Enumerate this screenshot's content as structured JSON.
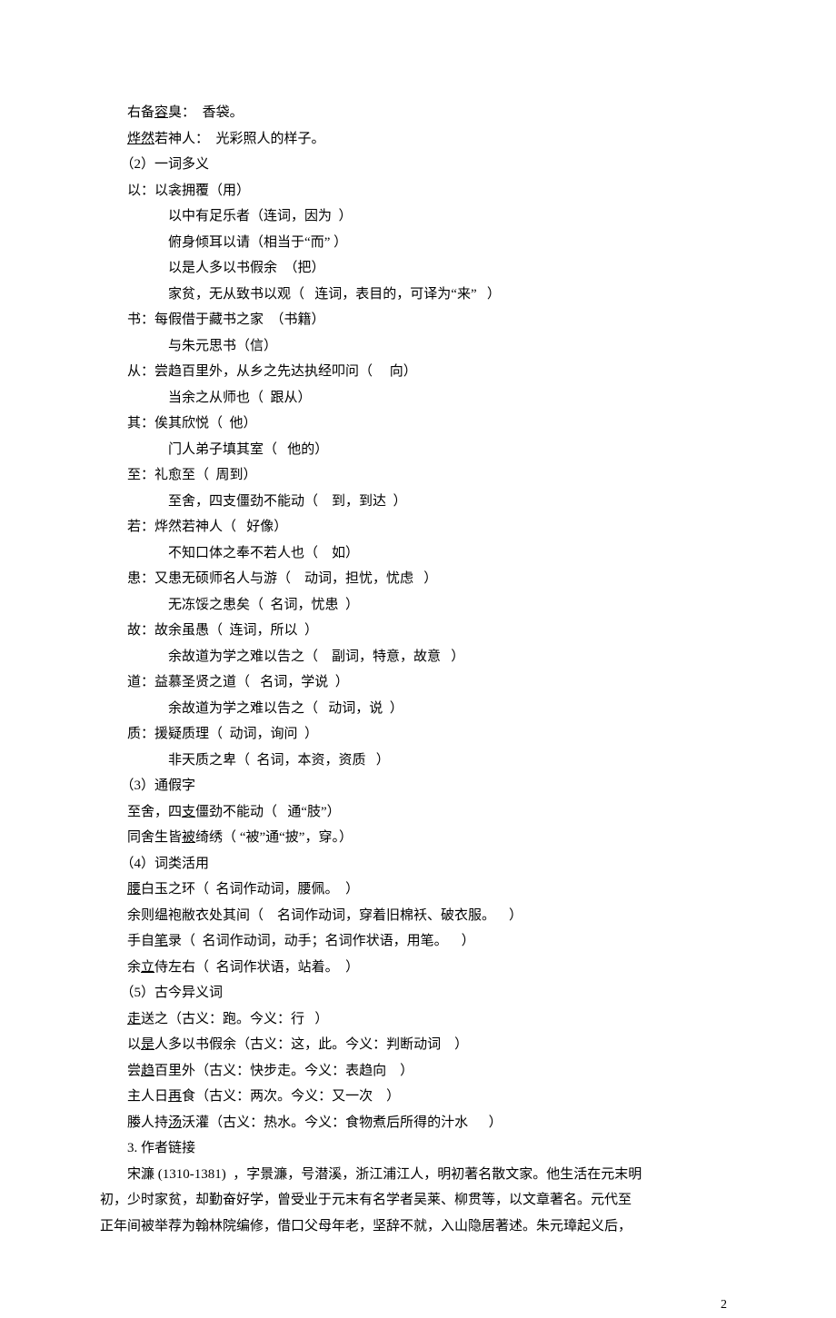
{
  "lines": [
    {
      "indent": 2,
      "segs": [
        [
          "右备",
          "plain"
        ],
        [
          "容",
          "u"
        ],
        [
          "臭：",
          "plain"
        ],
        [
          "  香袋。",
          "plain"
        ]
      ]
    },
    {
      "indent": 2,
      "segs": [
        [
          "烨然",
          "u"
        ],
        [
          "若神人：",
          "plain"
        ],
        [
          "  光彩照人的样子。",
          "plain"
        ]
      ]
    },
    {
      "indent": 2,
      "segs": [
        [
          "（2）一词多义",
          "plain"
        ]
      ]
    },
    {
      "indent": 2,
      "segs": [
        [
          "以：以衾拥覆",
          "plain"
        ],
        [
          "（用）",
          "plain"
        ]
      ]
    },
    {
      "indent": 5,
      "segs": [
        [
          "以中有足乐者",
          "plain"
        ],
        [
          "（连词，因为  ）",
          "plain"
        ]
      ]
    },
    {
      "indent": 5,
      "segs": [
        [
          "俯身倾耳以请",
          "plain"
        ],
        [
          "（相当于“而”",
          "plain"
        ],
        [
          " ）",
          "plain"
        ]
      ]
    },
    {
      "indent": 5,
      "segs": [
        [
          "以是人多以书假余",
          "plain"
        ],
        [
          "  （把）",
          "plain"
        ]
      ]
    },
    {
      "indent": 5,
      "segs": [
        [
          "家贫，无从致书以观（",
          "plain"
        ],
        [
          "   连词，表目的，可译为“来”",
          "plain"
        ],
        [
          "   ）",
          "plain"
        ]
      ]
    },
    {
      "indent": 2,
      "segs": [
        [
          "书：每假借于藏书之家",
          "plain"
        ],
        [
          "  （书籍）",
          "plain"
        ]
      ]
    },
    {
      "indent": 5,
      "segs": [
        [
          "与朱元思书",
          "plain"
        ],
        [
          "（信）",
          "plain"
        ]
      ]
    },
    {
      "indent": 2,
      "segs": [
        [
          "从：尝趋百里外，从乡之先达执经叩问（",
          "plain"
        ],
        [
          "     向）",
          "plain"
        ]
      ]
    },
    {
      "indent": 5,
      "segs": [
        [
          "当余之从师也（",
          "plain"
        ],
        [
          "  跟从）",
          "plain"
        ]
      ]
    },
    {
      "indent": 2,
      "segs": [
        [
          "其：俟其欣悦（",
          "plain"
        ],
        [
          "  他）",
          "plain"
        ]
      ]
    },
    {
      "indent": 5,
      "segs": [
        [
          "门人弟子填其室（",
          "plain"
        ],
        [
          "   他的）",
          "plain"
        ]
      ]
    },
    {
      "indent": 2,
      "segs": [
        [
          "至：礼愈至（",
          "plain"
        ],
        [
          "  周到）",
          "plain"
        ]
      ]
    },
    {
      "indent": 5,
      "segs": [
        [
          "至舍，四支僵劲不能动（",
          "plain"
        ],
        [
          "    到，到达  ）",
          "plain"
        ]
      ]
    },
    {
      "indent": 2,
      "segs": [
        [
          "若：烨然若神人（",
          "plain"
        ],
        [
          "   好像）",
          "plain"
        ]
      ]
    },
    {
      "indent": 5,
      "segs": [
        [
          "不知口体之奉不若人也（",
          "plain"
        ],
        [
          "    如）",
          "plain"
        ]
      ]
    },
    {
      "indent": 2,
      "segs": [
        [
          "患：又患无硕师名人与游（",
          "plain"
        ],
        [
          "    动词，担忧，忧虑",
          "plain"
        ],
        [
          "   ）",
          "plain"
        ]
      ]
    },
    {
      "indent": 5,
      "segs": [
        [
          "无冻馁之患矣（",
          "plain"
        ],
        [
          "  名词，忧患  ）",
          "plain"
        ]
      ]
    },
    {
      "indent": 2,
      "segs": [
        [
          "故：故余虽愚（",
          "plain"
        ],
        [
          "  连词，所以  ）",
          "plain"
        ]
      ]
    },
    {
      "indent": 5,
      "segs": [
        [
          "余故道为学之难以告之（",
          "plain"
        ],
        [
          "    副词，特意，故意",
          "plain"
        ],
        [
          "   ）",
          "plain"
        ]
      ]
    },
    {
      "indent": 2,
      "segs": [
        [
          "道：益慕圣贤之道（",
          "plain"
        ],
        [
          "   名词，学说  ）",
          "plain"
        ]
      ]
    },
    {
      "indent": 5,
      "segs": [
        [
          "余故道为学之难以告之（",
          "plain"
        ],
        [
          "   动词，说",
          "plain"
        ],
        [
          "  ）",
          "plain"
        ]
      ]
    },
    {
      "indent": 2,
      "segs": [
        [
          "质：援疑质理（",
          "plain"
        ],
        [
          "  动词，询问",
          "plain"
        ],
        [
          "  ）",
          "plain"
        ]
      ]
    },
    {
      "indent": 5,
      "segs": [
        [
          "非天质之卑（",
          "plain"
        ],
        [
          "  名词，本资，资质",
          "plain"
        ],
        [
          "   ）",
          "plain"
        ]
      ]
    },
    {
      "indent": 2,
      "segs": [
        [
          "（3）通假字",
          "plain"
        ]
      ]
    },
    {
      "indent": 2,
      "segs": [
        [
          "至舍，四",
          "plain"
        ],
        [
          "支",
          "u"
        ],
        [
          "僵劲不能动（",
          "plain"
        ],
        [
          "   通“肢”）",
          "plain"
        ]
      ]
    },
    {
      "indent": 2,
      "segs": [
        [
          "同舍生皆",
          "plain"
        ],
        [
          "被",
          "u"
        ],
        [
          "绮绣（",
          "plain"
        ],
        [
          " “被”通“披”",
          "plain"
        ],
        [
          "，穿。）",
          "plain"
        ]
      ]
    },
    {
      "indent": 2,
      "segs": [
        [
          "（4）词类活用",
          "plain"
        ]
      ]
    },
    {
      "indent": 2,
      "segs": [
        [
          "腰",
          "u"
        ],
        [
          "白玉之环（",
          "plain"
        ],
        [
          "  名词作动词，腰佩。",
          "plain"
        ],
        [
          "  ）",
          "plain"
        ]
      ]
    },
    {
      "indent": 2,
      "segs": [
        [
          "余则缊袍敝衣处其间（",
          "plain"
        ],
        [
          "    名词作动词，穿着旧棉袄、破衣服。",
          "plain"
        ],
        [
          "    ）",
          "plain"
        ]
      ]
    },
    {
      "indent": 2,
      "segs": [
        [
          "手自",
          "plain"
        ],
        [
          "笔",
          "u"
        ],
        [
          "录（",
          "plain"
        ],
        [
          "  名词作动词，动手；名词作状语，用笔。",
          "plain"
        ],
        [
          "    ）",
          "plain"
        ]
      ]
    },
    {
      "indent": 2,
      "segs": [
        [
          "余",
          "plain"
        ],
        [
          "立",
          "u"
        ],
        [
          "侍左右（",
          "plain"
        ],
        [
          "  名词作状语，站着。",
          "plain"
        ],
        [
          "  ）",
          "plain"
        ]
      ]
    },
    {
      "indent": 2,
      "segs": [
        [
          "（5）古今异义词",
          "plain"
        ]
      ]
    },
    {
      "indent": 2,
      "segs": [
        [
          "走",
          "u"
        ],
        [
          "送之",
          "plain"
        ],
        [
          "（古义：跑。今义：行",
          "plain"
        ],
        [
          "   ）",
          "plain"
        ]
      ]
    },
    {
      "indent": 2,
      "segs": [
        [
          "以",
          "plain"
        ],
        [
          "是",
          "u"
        ],
        [
          "人多以书假余",
          "plain"
        ],
        [
          "（古义：这，此。今义：判断动词",
          "plain"
        ],
        [
          "    ）",
          "plain"
        ]
      ]
    },
    {
      "indent": 2,
      "segs": [
        [
          "尝",
          "plain"
        ],
        [
          "趋",
          "u"
        ],
        [
          "百里外",
          "plain"
        ],
        [
          "（古义：快步走。今义：表趋向",
          "plain"
        ],
        [
          "    ）",
          "plain"
        ]
      ]
    },
    {
      "indent": 2,
      "segs": [
        [
          "主人日",
          "plain"
        ],
        [
          "再",
          "u"
        ],
        [
          "食",
          "plain"
        ],
        [
          "（古义：两次。今义：又一次",
          "plain"
        ],
        [
          "    ）",
          "plain"
        ]
      ]
    },
    {
      "indent": 2,
      "segs": [
        [
          "媵人持",
          "plain"
        ],
        [
          "汤",
          "u"
        ],
        [
          "沃灌",
          "plain"
        ],
        [
          "（古义：热水。今义：食物煮后所得的汁水",
          "plain"
        ],
        [
          "      ）",
          "plain"
        ]
      ]
    },
    {
      "indent": 2,
      "segs": [
        [
          "3. 作者链接",
          "plain"
        ]
      ]
    },
    {
      "indent": 2,
      "segs": [
        [
          "宋濂 (1310-1381)  ，字景濂，号潜溪，浙江浦江人，明初著名散文家。他生活在元末明",
          "plain"
        ]
      ]
    },
    {
      "indent": 0,
      "segs": [
        [
          "初，少时家贫，却勤奋好学，曾受业于元末有名学者吴莱、柳贯等，以文章著名。元代至",
          "plain"
        ]
      ]
    },
    {
      "indent": 0,
      "segs": [
        [
          "正年间被举荐为翰林院编修，借口父母年老，坚辞不就，入山隐居著述。朱元璋起义后，",
          "plain"
        ]
      ]
    }
  ],
  "pageNumber": "2"
}
